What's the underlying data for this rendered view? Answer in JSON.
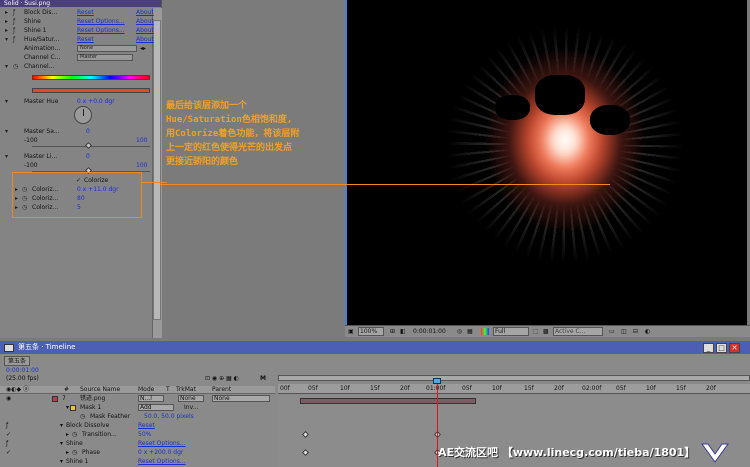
{
  "effects_panel": {
    "title": "Solid · Susi.png",
    "rows": [
      {
        "name": "Block Dis...",
        "reset": "Reset",
        "about": "About"
      },
      {
        "name": "Shine",
        "reset": "Reset Options...",
        "about": "About"
      },
      {
        "name": "Shine 1",
        "reset": "Reset Options...",
        "about": "About"
      },
      {
        "name": "Hue/Satur...",
        "reset": "Reset",
        "about": "About"
      }
    ],
    "animation_label": "Animation...",
    "animation_value": "None",
    "channel_label": "Channel C...",
    "channel_value": "Master",
    "channel_range_label": "Channel...",
    "master_hue_label": "Master Hue",
    "master_hue_value": "0 x +0.0 dgr",
    "master_sat_label": "Master Sa...",
    "master_light_label": "Master Li...",
    "range_min": "-100",
    "range_max": "100",
    "range_zero": "0",
    "colorize_label": "Colorize",
    "colorize_hue_label": "Coloriz...",
    "colorize_hue_value": "0 x +11.0 dgr",
    "colorize_sat_label": "Coloriz...",
    "colorize_sat_value": "80",
    "colorize_light_label": "Coloriz...",
    "colorize_light_value": "5"
  },
  "annotation": {
    "lines": [
      "最后给该层添加一个",
      "Hue/Saturation色相饱和度,",
      "用Colorize着色功能，将该层附",
      "上一定的红色使得光芒的出发点",
      "更接近骄阳的颜色"
    ],
    "color": "#f3a020"
  },
  "viewer_bar": {
    "zoom": "100%",
    "timecode": "0:00:01:00",
    "resolution": "Full",
    "camera": "Active C..."
  },
  "timeline": {
    "title": "第五条 · Timeline",
    "tab": "第五条",
    "timecode": "0:00:01:00",
    "fps": "(25.00 fps)",
    "columns": {
      "source": "Source Name",
      "mode": "Mode",
      "t": "T",
      "trkmat": "TrkMat",
      "parent": "Parent"
    },
    "layer": {
      "num": "7",
      "name": "锈迹.png",
      "mode": "N...l",
      "trkmat": "None",
      "parent": "None"
    },
    "rows": [
      {
        "label": "Mask 1",
        "mode": "Add",
        "extra": "Inv..."
      },
      {
        "label": "Mask Feather",
        "value": "50.0, 50.0 pixels"
      },
      {
        "label": "Block Dissolve",
        "value": "Reset"
      },
      {
        "label": "Transition...",
        "value": "50%"
      },
      {
        "label": "Shine",
        "value": "Reset Options..."
      },
      {
        "label": "Phase",
        "value": "0 x +200.0 dgr"
      },
      {
        "label": "Shine 1",
        "value": "Reset Options..."
      }
    ],
    "ruler": [
      "00f",
      "05f",
      "10f",
      "15f",
      "20f",
      "01:00f",
      "05f",
      "10f",
      "15f",
      "20f",
      "02:00f",
      "05f",
      "10f",
      "15f",
      "20f"
    ]
  },
  "watermark": "AE交流区吧 【www.linecg.com/tieba/1801】"
}
